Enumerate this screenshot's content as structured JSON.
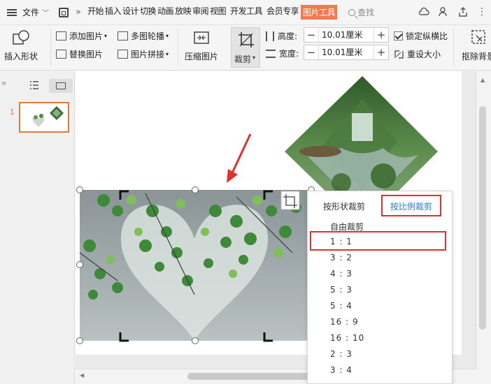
{
  "menubar": {
    "file": "文件",
    "tabs": [
      "开始",
      "插入",
      "设计",
      "切换",
      "动画",
      "放映",
      "审阅",
      "视图",
      "开发工具",
      "会员专享"
    ],
    "active_tab": "图片工具",
    "search": "查找"
  },
  "ribbon": {
    "insert_shape": "插入形状",
    "add_picture": "添加图片",
    "replace_picture": "替换图片",
    "multi_carousel": "多图轮播",
    "picture_stitch": "图片拼接",
    "compress": "压缩图片",
    "crop": "裁剪",
    "height_label": "高度:",
    "height_value": "10.01厘米",
    "width_label": "宽度:",
    "width_value": "10.01厘米",
    "lock_ratio": "锁定纵横比",
    "reset_size": "重设大小",
    "remove_bg": "抠除背景"
  },
  "pane": {
    "slide_number": "1"
  },
  "crop_menu": {
    "tab_shape": "按形状裁剪",
    "tab_ratio": "按比例裁剪",
    "free_crop": "自由裁剪",
    "ratios": [
      "1 : 1",
      "3 : 2",
      "4 : 3",
      "5 : 3",
      "5 : 4",
      "16 : 9",
      "16 : 10",
      "2 : 3",
      "3 : 4"
    ]
  },
  "colors": {
    "accent": "#f07c4d",
    "highlight": "#e03030",
    "link": "#2b7ad8"
  }
}
